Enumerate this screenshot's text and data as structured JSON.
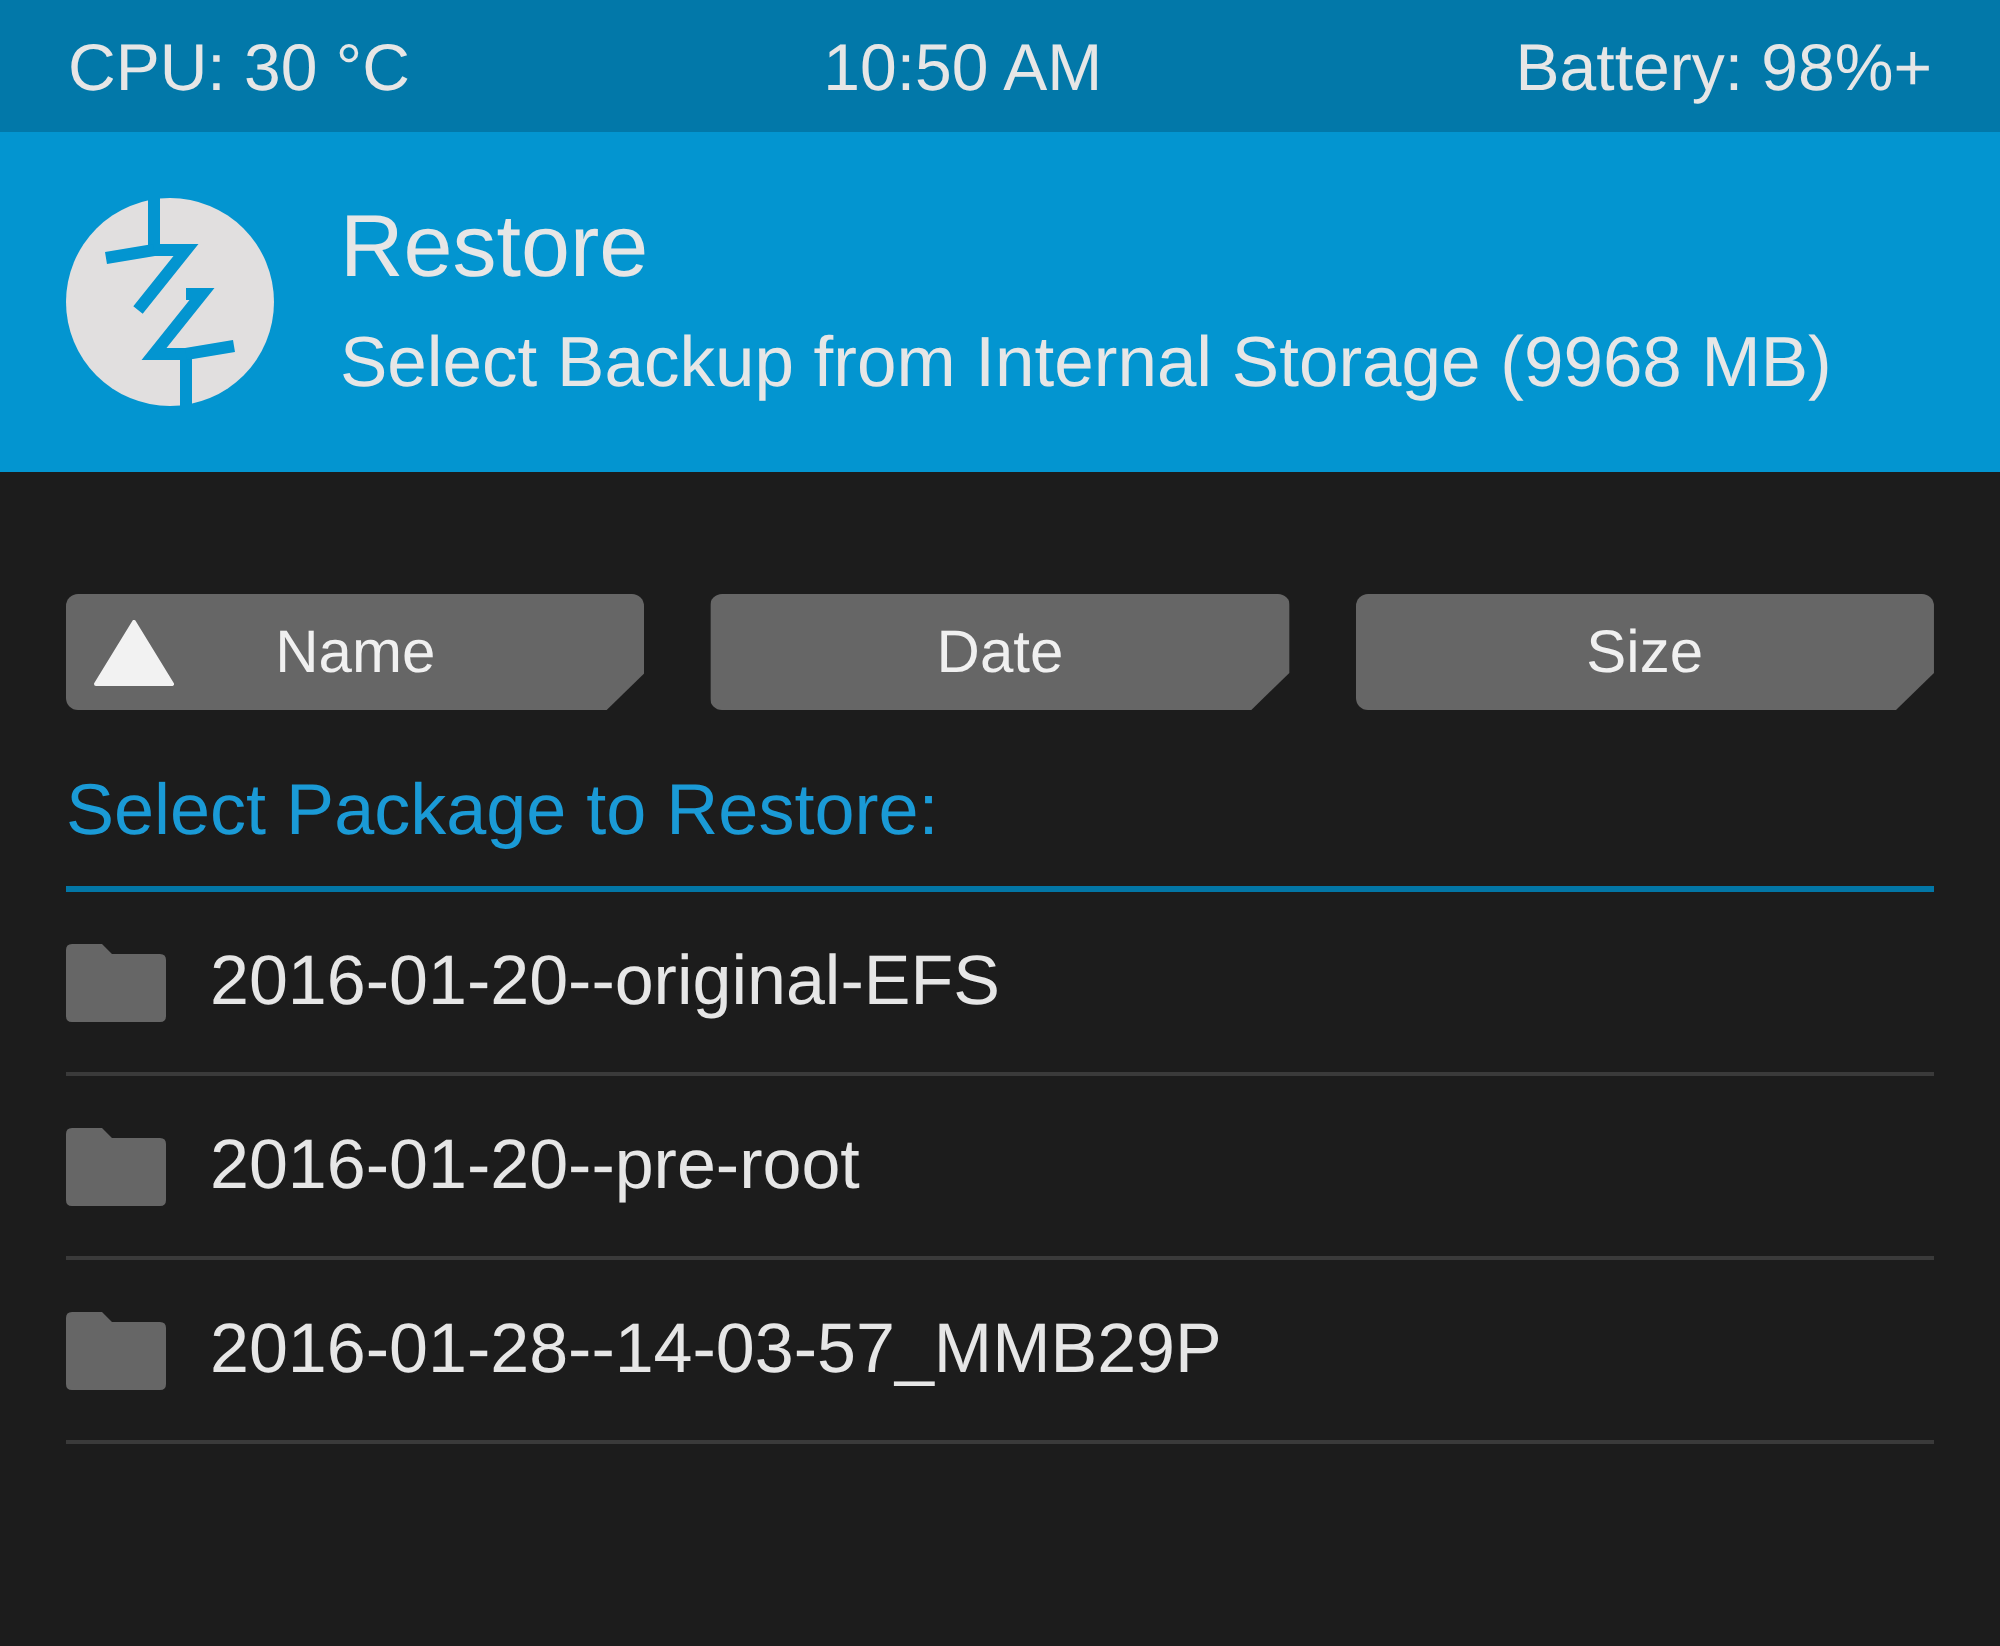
{
  "status_bar": {
    "cpu": "CPU: 30 °C",
    "time": "10:50 AM",
    "battery": "Battery: 98%+"
  },
  "header": {
    "title": "Restore",
    "subtitle": "Select Backup from Internal Storage (9968 MB)"
  },
  "sort_buttons": [
    {
      "label": "Name",
      "selected": true
    },
    {
      "label": "Date",
      "selected": false
    },
    {
      "label": "Size",
      "selected": false
    }
  ],
  "list_label": "Select Package to Restore:",
  "packages": [
    {
      "name": "2016-01-20--original-EFS"
    },
    {
      "name": "2016-01-20--pre-root"
    },
    {
      "name": "2016-01-28--14-03-57_MMB29P"
    }
  ]
}
